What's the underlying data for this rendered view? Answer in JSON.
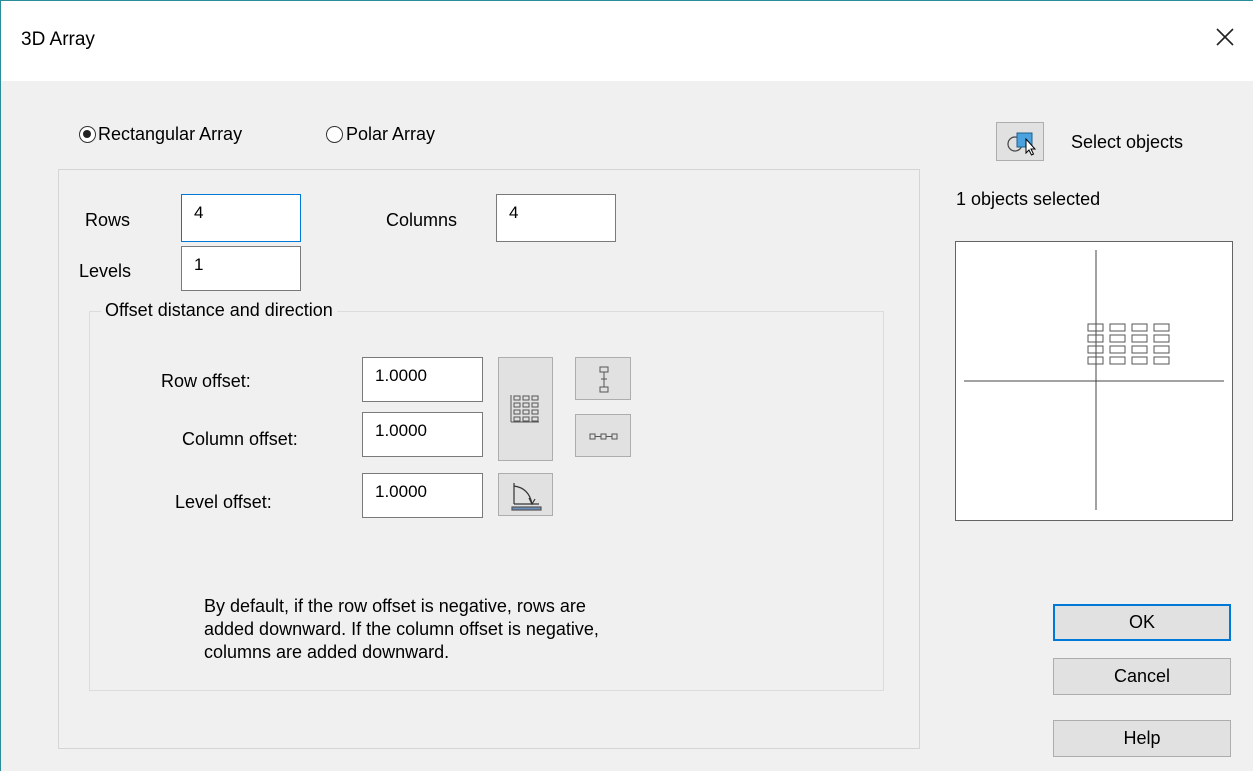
{
  "window": {
    "title": "3D Array",
    "close_icon": "close-icon"
  },
  "array_type": {
    "selected": "Rectangular Array",
    "options": [
      "Rectangular Array",
      "Polar Array"
    ]
  },
  "counts": {
    "rows_label": "Rows",
    "rows_value": "4",
    "columns_label": "Columns",
    "columns_value": "4",
    "levels_label": "Levels",
    "levels_value": "1"
  },
  "offsets": {
    "group_label": "Offset distance and direction",
    "row_offset_label": "Row offset:",
    "row_offset_value": "1.0000",
    "column_offset_label": "Column offset:",
    "column_offset_value": "1.0000",
    "level_offset_label": "Level offset:",
    "level_offset_value": "1.0000",
    "note": "By default, if the row offset is negative, rows are added downward. If the column offset is negative, columns are added downward."
  },
  "selection": {
    "select_objects_label": "Select objects",
    "status": "1 objects selected",
    "select_icon": "select-objects-icon"
  },
  "buttons": {
    "ok": "OK",
    "cancel": "Cancel",
    "help": "Help"
  },
  "preview": {
    "rows": 4,
    "columns": 4
  },
  "colors": {
    "accent": "#0078d7",
    "window_border": "#2a8d9a",
    "dialog_bg": "#f0f0f0"
  }
}
